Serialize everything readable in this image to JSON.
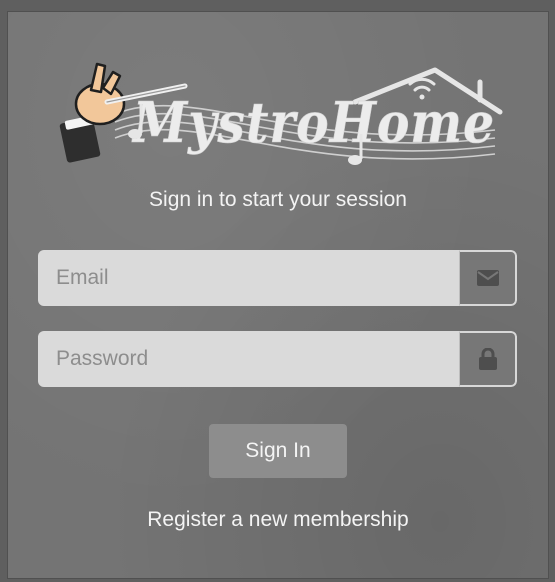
{
  "brand": {
    "logo_text": "MystroHome",
    "logo_icon": "conductor-hand-baton"
  },
  "login": {
    "tagline": "Sign in to start your session",
    "email_placeholder": "Email",
    "email_icon": "envelope-icon",
    "password_placeholder": "Password",
    "password_icon": "lock-icon",
    "signin_label": "Sign In",
    "register_label": "Register a new membership"
  },
  "colors": {
    "page_bg": "#5f5f5f",
    "panel_bg": "#747474",
    "input_bg": "#dadada",
    "button_bg": "#8d8d8d"
  }
}
